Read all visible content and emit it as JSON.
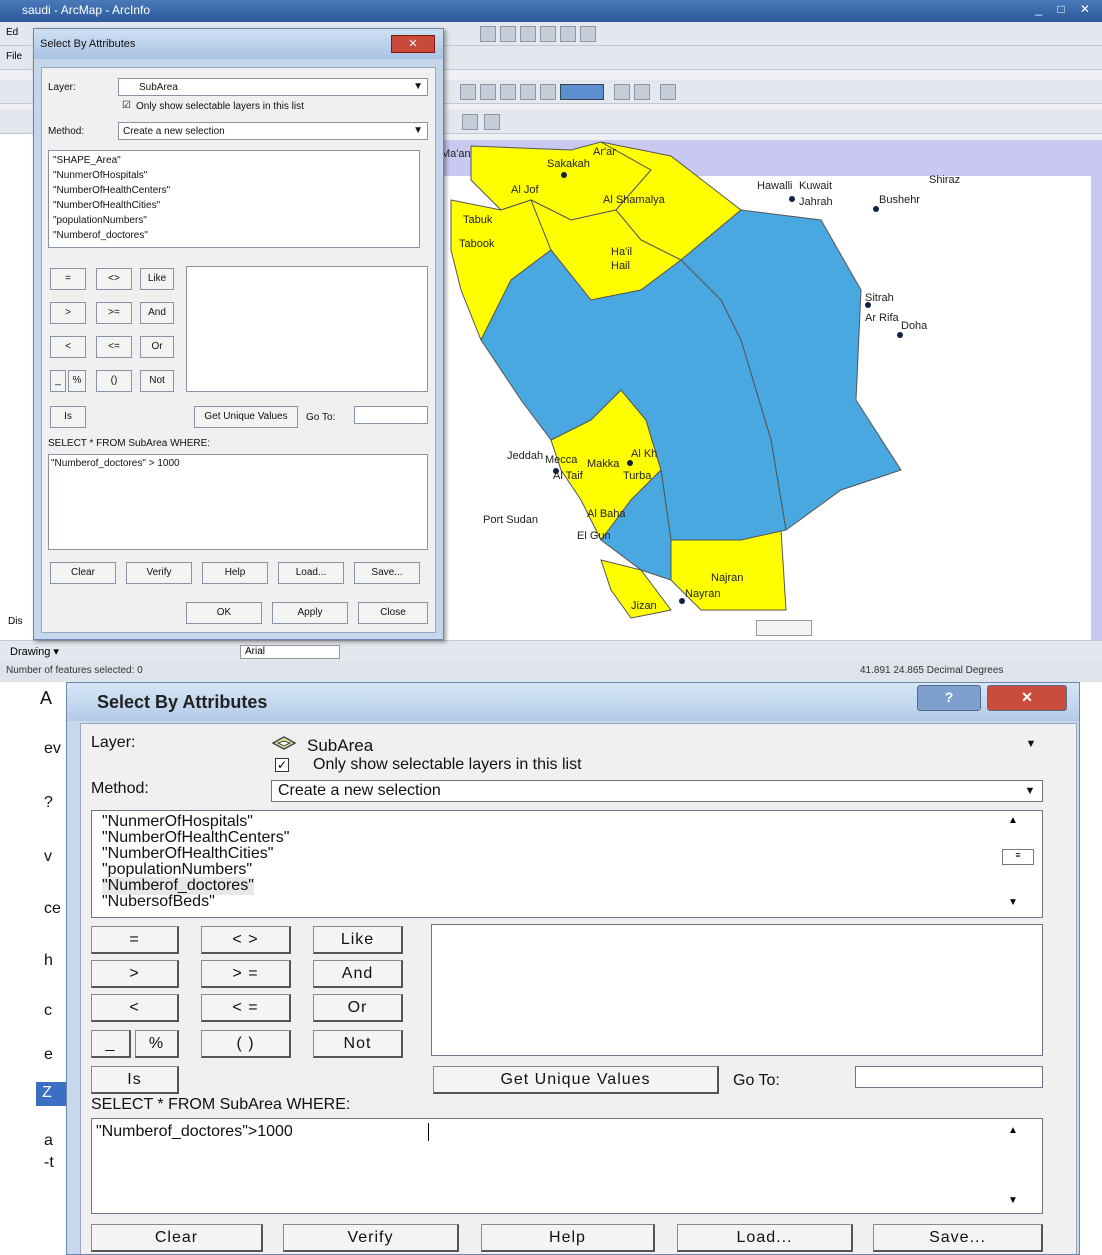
{
  "app": {
    "title": "saudi - ArcMap - ArcInfo",
    "window_buttons": "_ □ ✕",
    "menu_stub": [
      "Ed",
      "File",
      "",
      ""
    ],
    "drawing_label": "Drawing ▾",
    "font_name": "Arial",
    "status_left": "Number of features selected: 0",
    "status_right": "41.891  24.865 Decimal Degrees",
    "side_stub": "Dis"
  },
  "map": {
    "colors": {
      "selected": "#ffff00",
      "unselected": "#4aa8e0",
      "water": "#c8c8f0",
      "border": "#555555"
    },
    "labels": [
      "Ar'ar",
      "Sakakah",
      "Al Jof",
      "Al Shamalya",
      "Tabuk",
      "Tabook",
      "Ha'il",
      "Hail",
      "Hawalli",
      "Kuwait",
      "Jahrah",
      "Bushehr",
      "Shiraz",
      "Sitrah",
      "Ar Rifa",
      "Doha",
      "Jeddah",
      "Mecca",
      "Makka",
      "Al Taif",
      "Turba",
      "Al Kh",
      "Port Sudan",
      "Al Baha",
      "El Gun",
      "Najran",
      "Nayran",
      "Jizan",
      "Ma'an"
    ]
  },
  "small_dialog": {
    "title": "Select By Attributes",
    "close_glyph": "✕",
    "layer_label": "Layer:",
    "layer_value": "SubArea",
    "only_selectable": "Only show selectable layers in this list",
    "method_label": "Method:",
    "method_value": "Create a new selection",
    "fields": [
      "\"SHAPE_Area\"",
      "\"NunmerOfHospitals\"",
      "\"NumberOfHealthCenters\"",
      "\"NumberOfHealthCities\"",
      "\"populationNumbers\"",
      "\"Numberof_doctores\""
    ],
    "operators": [
      "=",
      "<>",
      "Like",
      ">",
      ">=",
      "And",
      "<",
      "<=",
      "Or",
      "_",
      "%",
      "()",
      "Not",
      "Is"
    ],
    "get_unique": "Get Unique Values",
    "goto": "Go To:",
    "select_from": "SELECT * FROM SubArea WHERE:",
    "expression": "\"Numberof_doctores\" > 1000",
    "buttons": [
      "Clear",
      "Verify",
      "Help",
      "Load...",
      "Save..."
    ],
    "ok": "OK",
    "apply": "Apply",
    "close": "Close"
  },
  "big_dialog": {
    "title": "Select By Attributes",
    "help_glyph": "?",
    "close_glyph": "✕",
    "layer_label": "Layer:",
    "layer_value": "SubArea",
    "only_selectable": "Only show selectable layers in this list",
    "method_label": "Method:",
    "method_value": "Create a new selection",
    "fields": [
      "\"NunmerOfHospitals\"",
      "\"NumberOfHealthCenters\"",
      "\"NumberOfHealthCities\"",
      "\"populationNumbers\"",
      "\"Numberof_doctores\"",
      "\"NubersofBeds\""
    ],
    "operators": [
      "=",
      "< >",
      "Like",
      ">",
      "> =",
      "And",
      "<",
      "< =",
      "Or",
      "_",
      "%",
      "( )",
      "Not",
      "Is"
    ],
    "get_unique": "Get Unique Values",
    "goto": "Go To:",
    "select_from": "SELECT * FROM SubArea WHERE:",
    "expression": "\"Numberof_doctores\">1000",
    "buttons": [
      "Clear",
      "Verify",
      "Help",
      "Load...",
      "Save..."
    ],
    "left_stub": [
      "A",
      "ev",
      "?",
      "v",
      "ce",
      "h",
      "c",
      "e",
      "Z",
      "a",
      "-t"
    ]
  }
}
